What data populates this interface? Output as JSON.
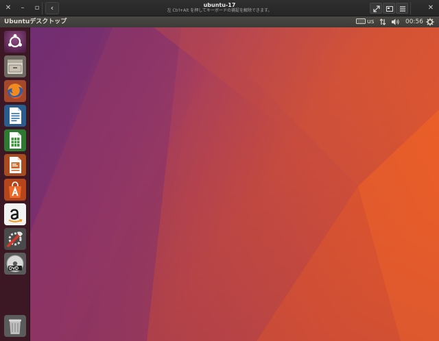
{
  "viewer": {
    "title": "ubuntu-17",
    "subtitle": "左 Ctrl+Alt を押してキーボードの捕捉を解除できます。",
    "back_icon": "chevron-left-icon",
    "tools": [
      "fullscreen-icon",
      "display-icon",
      "menu-icon"
    ]
  },
  "panel": {
    "desktop_title": "Ubuntuデスクトップ",
    "keyboard_layout": "us",
    "clock": "00:56",
    "indicators": [
      "keyboard-icon",
      "network-icon",
      "volume-icon",
      "gear-icon"
    ]
  },
  "launcher": {
    "items": [
      {
        "name": "dash-home",
        "icon": "ubuntu-logo-icon"
      },
      {
        "name": "files",
        "icon": "file-cabinet-icon"
      },
      {
        "name": "firefox",
        "icon": "firefox-icon"
      },
      {
        "name": "libreoffice-writer",
        "icon": "writer-document-icon"
      },
      {
        "name": "libreoffice-calc",
        "icon": "calc-spreadsheet-icon"
      },
      {
        "name": "libreoffice-impress",
        "icon": "impress-presentation-icon"
      },
      {
        "name": "ubuntu-software",
        "icon": "software-bag-icon"
      },
      {
        "name": "amazon",
        "icon": "amazon-icon"
      },
      {
        "name": "system-settings",
        "icon": "settings-wrench-icon"
      },
      {
        "name": "dvd",
        "icon": "dvd-icon"
      }
    ],
    "trash": {
      "name": "trash",
      "icon": "trash-icon"
    }
  },
  "colors": {
    "accent": "#e95420",
    "launcher": "#3e1624",
    "panel": "#3c3b37",
    "wallpaper_start": "#7b2f6e",
    "wallpaper_end": "#ea5a24"
  }
}
